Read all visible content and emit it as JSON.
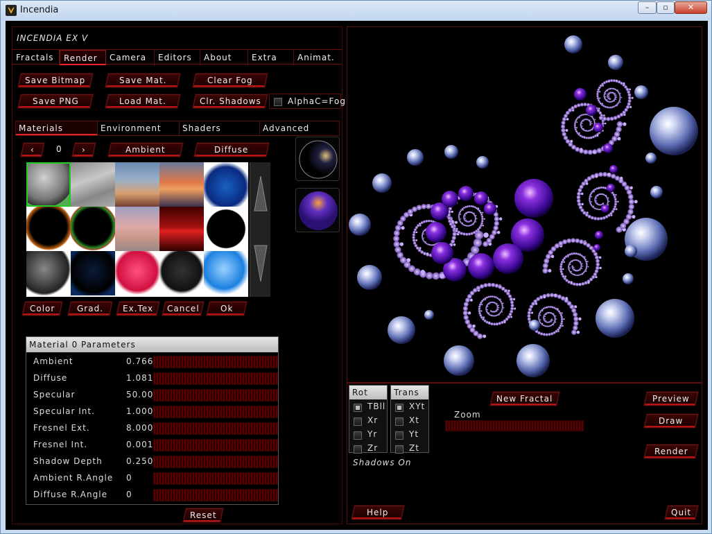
{
  "window": {
    "title": "Incendia",
    "min": "–",
    "max": "▫",
    "close": "✕"
  },
  "app_title": "INCENDIA EX V",
  "tabs": [
    "Fractals",
    "Render",
    "Camera",
    "Editors",
    "About",
    "Extra",
    "Animat."
  ],
  "render_buttons": {
    "save_bitmap": "Save Bitmap",
    "save_mat": "Save Mat.",
    "clear_fog": "Clear Fog",
    "save_png": "Save PNG",
    "load_mat": "Load Mat.",
    "clr_shadows": "Clr. Shadows",
    "alphac_fog": "AlphaC=Fog"
  },
  "subtabs": [
    "Materials",
    "Environment",
    "Shaders",
    "Advanced"
  ],
  "material": {
    "prev": "‹",
    "index": "0",
    "next": "›",
    "ambient": "Ambient",
    "diffuse": "Diffuse"
  },
  "grid_buttons": {
    "color": "Color",
    "grad": "Grad.",
    "extex": "Ex.Tex",
    "cancel": "Cancel",
    "ok": "Ok"
  },
  "params": {
    "title": "Material 0  Parameters",
    "rows": [
      {
        "label": "Ambient",
        "value": "0.766"
      },
      {
        "label": "Diffuse",
        "value": "1.081"
      },
      {
        "label": "Specular",
        "value": "50.00"
      },
      {
        "label": "Specular Int.",
        "value": "1.000"
      },
      {
        "label": "Fresnel Ext.",
        "value": "8.000"
      },
      {
        "label": "Fresnel Int.",
        "value": "0.001"
      },
      {
        "label": "Shadow Depth",
        "value": "0.250"
      },
      {
        "label": "Ambient R.Angle",
        "value": "0"
      },
      {
        "label": "Diffuse R.Angle",
        "value": "0"
      }
    ],
    "reset": "Reset"
  },
  "controls": {
    "rot": {
      "head": "Rot",
      "items": [
        "TBll",
        "Xr",
        "Yr",
        "Zr"
      ]
    },
    "trans": {
      "head": "Trans",
      "items": [
        "XYt",
        "Xt",
        "Yt",
        "Zt"
      ]
    },
    "shadows": "Shadows  On",
    "new_fractal": "New Fractal",
    "zoom": "Zoom",
    "preview": "Preview",
    "draw": "Draw",
    "render": "Render",
    "help": "Help",
    "quit": "Quit"
  },
  "colors": {
    "accent": "#cc1111",
    "panel_border": "#5a0e0e",
    "background": "#000000"
  }
}
